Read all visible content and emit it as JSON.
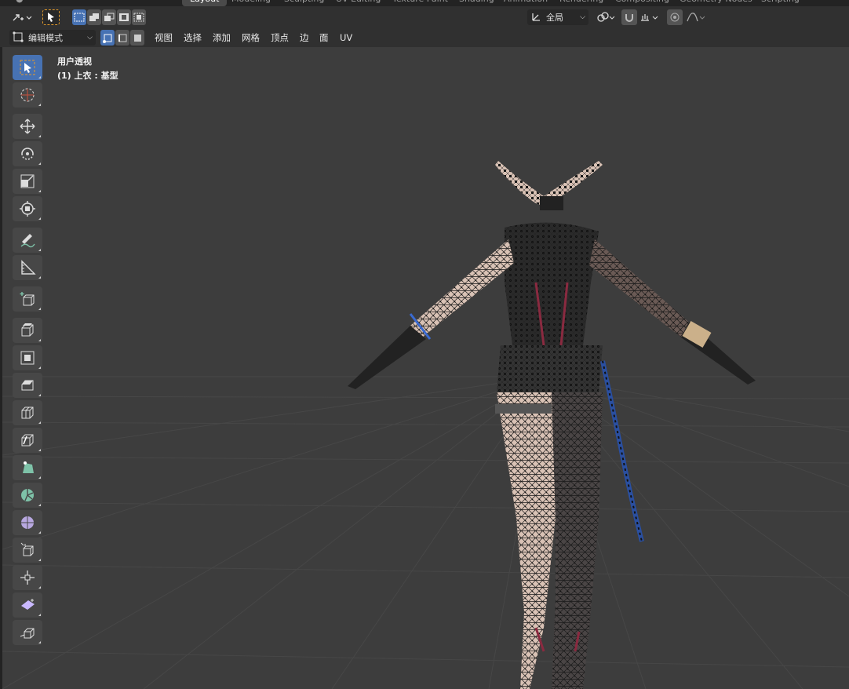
{
  "workspace_tabs": [
    "Layout",
    "Modeling",
    "Sculpting",
    "UV Editing",
    "Texture Paint",
    "Shading",
    "Animation",
    "Rendering",
    "Compositing",
    "Geometry Nodes",
    "Scripting"
  ],
  "header": {
    "transform_orientation": "全局",
    "mode_select": "编辑模式",
    "menu": [
      "视图",
      "选择",
      "添加",
      "网格",
      "顶点",
      "边",
      "面",
      "UV"
    ]
  },
  "viewport": {
    "view_name": "用户透视",
    "object_info": "(1) 上衣 : 基型"
  },
  "toolbar": {
    "tools": [
      "select-box",
      "cursor",
      "move",
      "rotate",
      "scale",
      "transform",
      "annotate",
      "measure",
      "add-cube",
      "extrude-region",
      "inset-faces",
      "bevel",
      "loop-cut",
      "knife",
      "poly-build",
      "spin",
      "smooth",
      "shrink-fatten",
      "push-pull",
      "shear",
      "rip-region"
    ]
  },
  "colors": {
    "viewport_bg": "#3d3d3d",
    "header_bg": "#303030",
    "active_blue": "#4772b3",
    "grid_line": "#4a4a4a",
    "mesh_skin": "#d9c2b5",
    "mesh_vertex": "#111111"
  }
}
